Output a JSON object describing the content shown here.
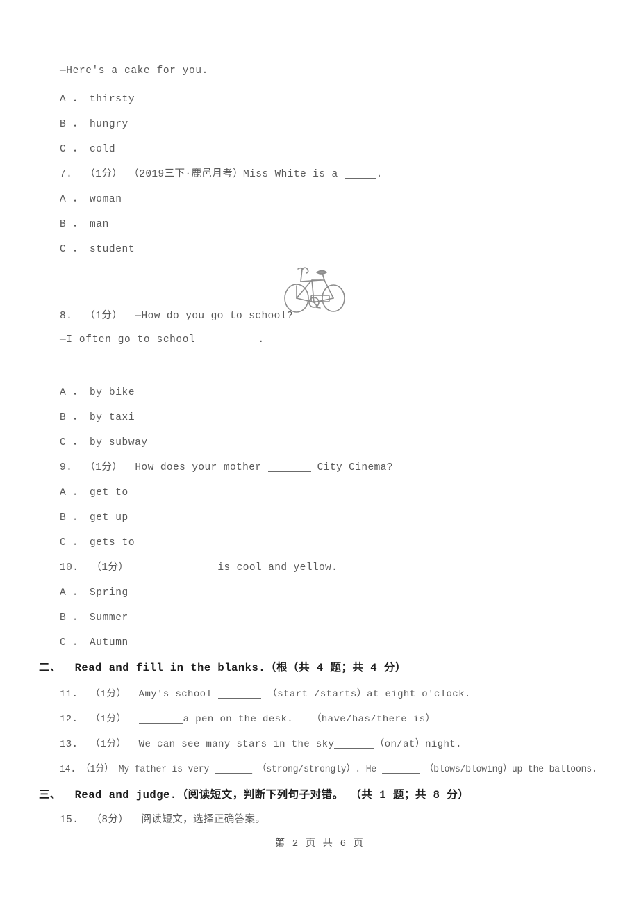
{
  "document": {
    "page_footer": "第 2 页 共 6 页",
    "page_number": "2",
    "total_pages": "6",
    "text_color": "#595959",
    "heading_color": "#1d1d1d"
  },
  "continued_question": {
    "stem": "—Here's a cake for you.",
    "options": [
      "A ． thirsty",
      "B ． hungry",
      "C ． cold"
    ]
  },
  "questions": [
    {
      "number": "7.",
      "points": "（1分）",
      "tag": "（2019三下·鹿邑月考）",
      "stem_before": "Miss White is a ",
      "stem_after": ".",
      "has_blank": true,
      "options": [
        "A ． woman",
        "B ． man",
        "C ． student"
      ]
    },
    {
      "number": "8.",
      "points": "（1分）",
      "stem_line1": "—How do you go to school?",
      "stem_line2_before": "—I often go to school",
      "stem_line2_after": ".",
      "figure": "bicycle-illustration",
      "options": [
        "A ． by bike",
        "B ． by taxi",
        "C ． by subway"
      ]
    },
    {
      "number": "9.",
      "points": "（1分）",
      "stem_before": "How does your mother ",
      "stem_after": " City Cinema?",
      "has_blank": true,
      "options": [
        "A ． get to",
        "B ． get up",
        "C ． gets to"
      ]
    },
    {
      "number": "10.",
      "points": "（1分）",
      "stem_before": "",
      "stem_after": "is cool and yellow.",
      "has_blank": true,
      "options": [
        "A ． Spring",
        "B ． Summer",
        "C ． Autumn"
      ]
    }
  ],
  "section_two": {
    "heading": "二、  Read and fill in the blanks.（根（共 4 题；共 4 分）",
    "items": [
      {
        "number": "11.",
        "points": "（1分）",
        "text_a": "Amy's school ",
        "text_b": "（start /starts）at eight o'clock."
      },
      {
        "number": "12.",
        "points": "（1分）",
        "text_a": "",
        "text_b": "a pen on the desk.   （have/has/there is）"
      },
      {
        "number": "13.",
        "points": "（1分）",
        "text_a": "We can see many stars in the sky",
        "text_b": "（on/at）night."
      },
      {
        "number": "14.",
        "points": "（1分）",
        "text_a": "My father is very ",
        "text_b": "（strong/strongly）. He ",
        "text_c": "（blows/blowing）up the balloons."
      }
    ]
  },
  "section_three": {
    "heading": "三、  Read and judge.（阅读短文，判断下列句子对错。 （共 1 题；共 8 分）",
    "items": [
      {
        "number": "15.",
        "points": "（8分）",
        "text": "阅读短文，选择正确答案。"
      }
    ]
  }
}
